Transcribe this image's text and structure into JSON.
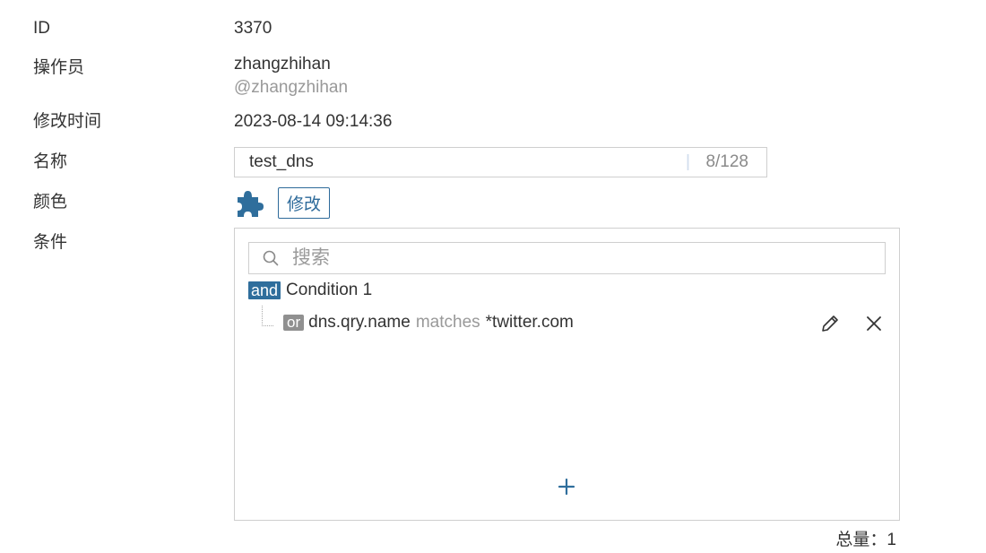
{
  "fields": {
    "id": {
      "label": "ID",
      "value": "3370"
    },
    "operator": {
      "label": "操作员",
      "name": "zhangzhihan",
      "handle": "@zhangzhihan"
    },
    "modified": {
      "label": "修改时间",
      "value": "2023-08-14 09:14:36"
    },
    "name": {
      "label": "名称",
      "value": "test_dns",
      "counter": "8/128"
    },
    "color": {
      "label": "颜色",
      "icon": "puzzle-icon",
      "icon_color": "#2f6e9c",
      "button": "修改"
    },
    "condition": {
      "label": "条件"
    }
  },
  "conditions": {
    "search_placeholder": "搜索",
    "root": {
      "op": "and",
      "label": "Condition 1"
    },
    "child": {
      "op": "or",
      "field": "dns.qry.name",
      "operator": "matches",
      "value": "*twitter.com"
    },
    "add_symbol": "+"
  },
  "footer": {
    "total": "总量：1"
  },
  "colors": {
    "accent": "#2f6e9c",
    "border": "#cfcfcf",
    "muted": "#999999"
  }
}
